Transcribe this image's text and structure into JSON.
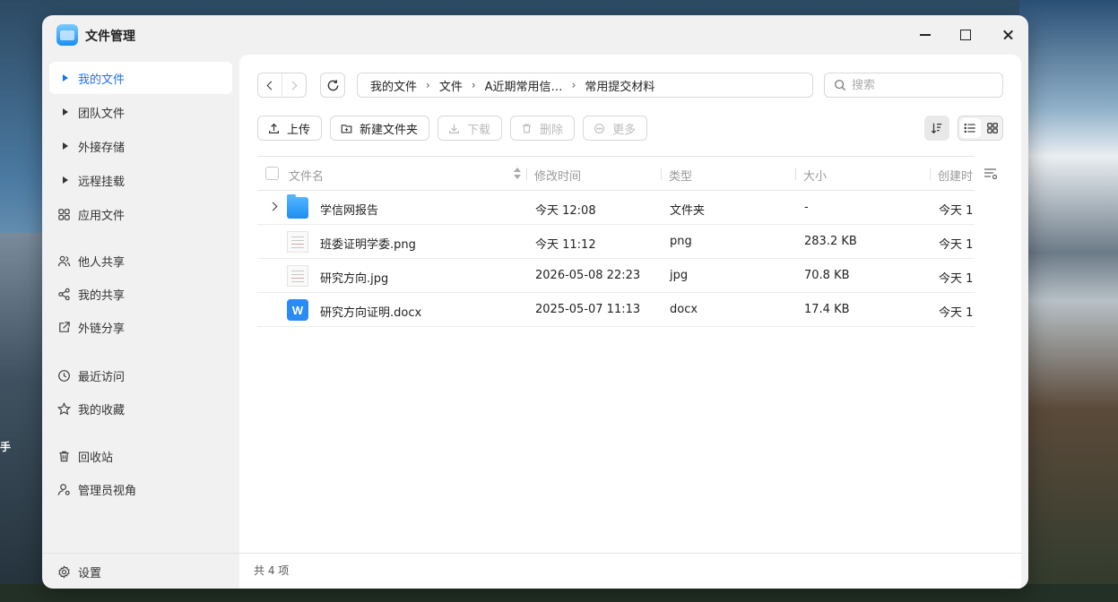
{
  "app": {
    "title": "文件管理"
  },
  "desktop": {
    "label": "手"
  },
  "sidebar": {
    "items": [
      {
        "label": "我的文件"
      },
      {
        "label": "团队文件"
      },
      {
        "label": "外接存储"
      },
      {
        "label": "远程挂载"
      },
      {
        "label": "应用文件"
      },
      {
        "label": "他人共享"
      },
      {
        "label": "我的共享"
      },
      {
        "label": "外链分享"
      },
      {
        "label": "最近访问"
      },
      {
        "label": "我的收藏"
      },
      {
        "label": "回收站"
      },
      {
        "label": "管理员视角"
      }
    ],
    "settings_label": "设置"
  },
  "breadcrumb": [
    "我的文件",
    "文件",
    "A近期常用信…",
    "常用提交材料"
  ],
  "search": {
    "placeholder": "搜索"
  },
  "toolbar": {
    "upload": "上传",
    "new_folder": "新建文件夹",
    "download": "下载",
    "delete": "删除",
    "more": "更多"
  },
  "columns": {
    "name": "文件名",
    "modified": "修改时间",
    "type": "类型",
    "size": "大小",
    "created": "创建时"
  },
  "files": [
    {
      "name": "学信网报告",
      "modified": "今天 12:08",
      "type": "文件夹",
      "size": "-",
      "created": "今天 1",
      "icon": "folder-icon"
    },
    {
      "name": "班委证明学委.png",
      "modified": "今天 11:12",
      "type": "png",
      "size": "283.2 KB",
      "created": "今天 1",
      "icon": "image-thumbnail-icon"
    },
    {
      "name": "研究方向.jpg",
      "modified": "2026-05-08 22:23",
      "type": "jpg",
      "size": "70.8 KB",
      "created": "今天 1",
      "icon": "image-thumbnail-icon"
    },
    {
      "name": "研究方向证明.docx",
      "modified": "2025-05-07 11:13",
      "type": "docx",
      "size": "17.4 KB",
      "created": "今天 1",
      "icon": "word-doc-icon",
      "icon_letter": "W"
    }
  ],
  "status": {
    "count_text": "共 4 项"
  },
  "colors": {
    "accent": "#1a73e8",
    "folder": "#2f9bf5",
    "doc": "#2b8bf2"
  }
}
